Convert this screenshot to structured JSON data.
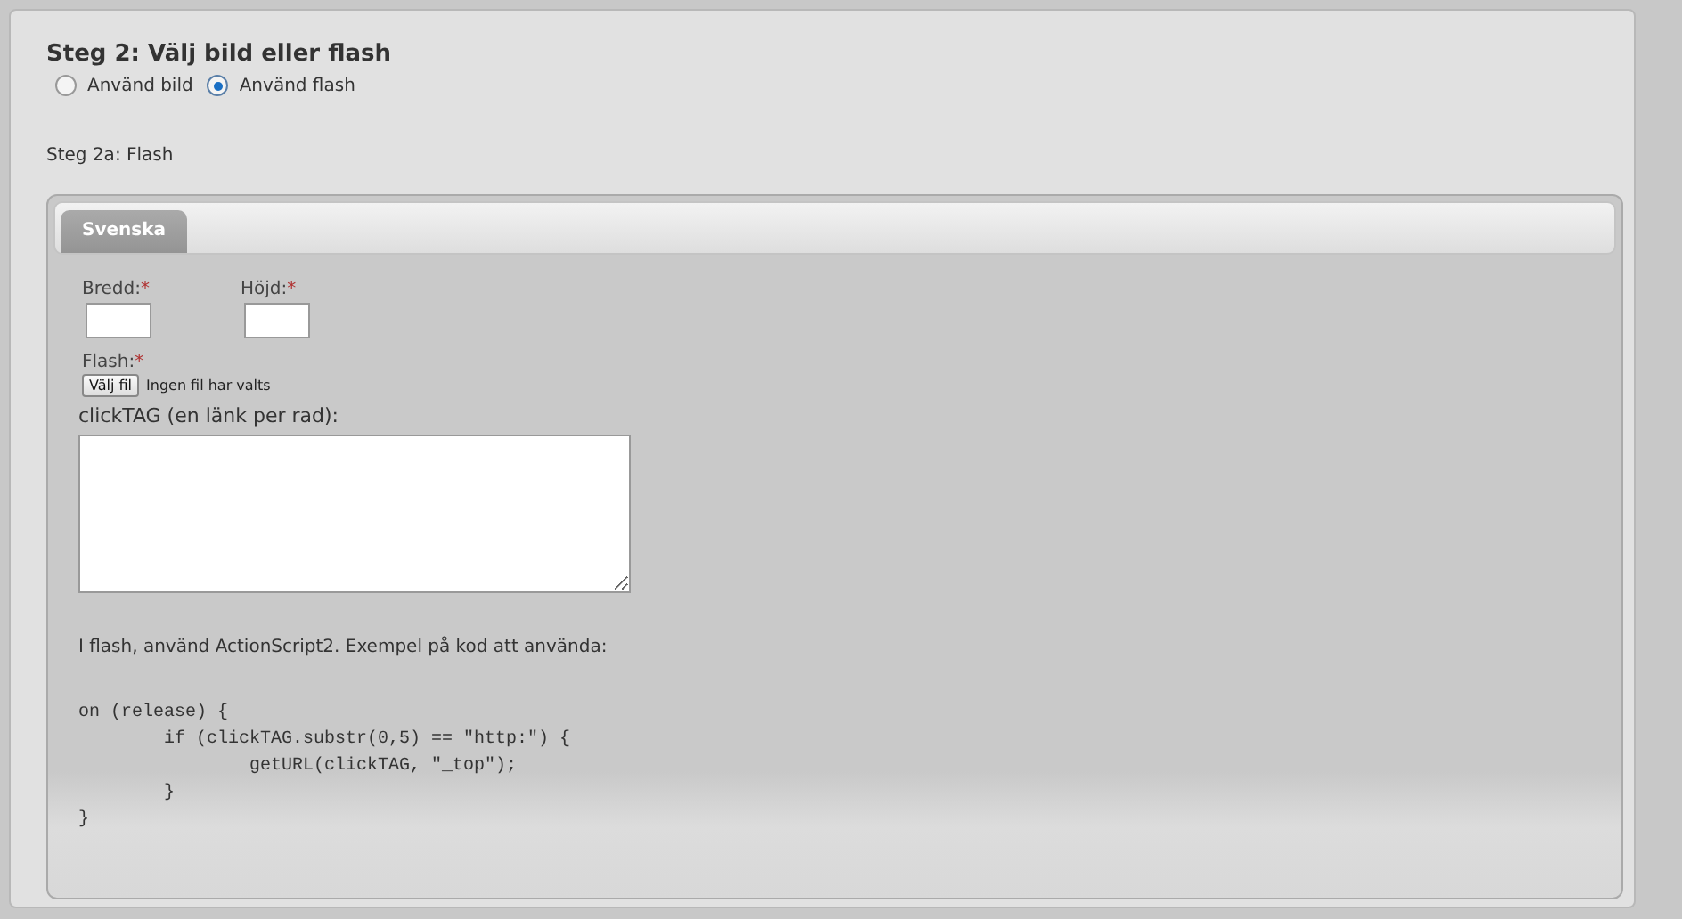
{
  "heading": "Steg 2: Välj bild eller flash",
  "media_options": [
    {
      "label": "Använd bild",
      "selected": false
    },
    {
      "label": "Använd flash",
      "selected": true
    }
  ],
  "subheading": "Steg 2a: Flash",
  "tabs": [
    {
      "label": "Svenska",
      "selected": true
    }
  ],
  "fields": [
    {
      "label": "Bredd:",
      "required_mark": "*"
    },
    {
      "label": "Höjd:",
      "required_mark": "*"
    }
  ],
  "file_field": {
    "label": "Flash:",
    "required_mark": "*",
    "button": "Välj fil",
    "status": "Ingen fil har valts"
  },
  "clicktag": {
    "label": "clickTAG (en länk per rad):"
  },
  "instructions": "I flash, använd ActionScript2. Exempel på kod att använda:",
  "code": "on (release) {\n        if (clickTAG.substr(0,5) == \"http:\") {\n                getURL(clickTAG, \"_top\");\n        }\n}"
}
